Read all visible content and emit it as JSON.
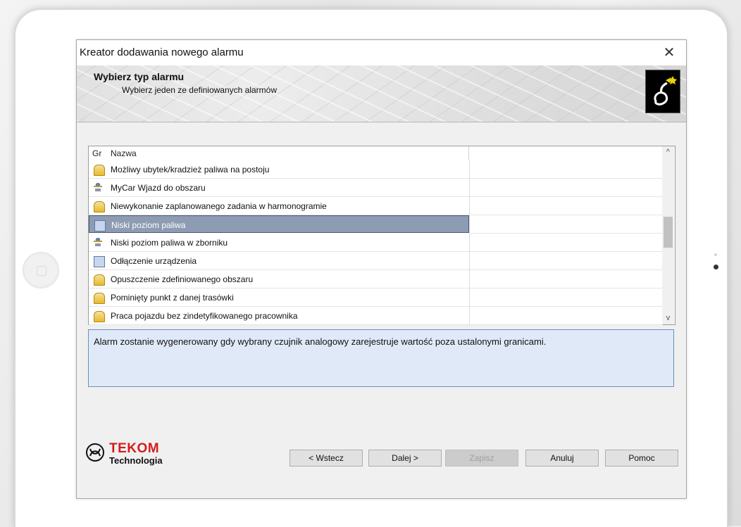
{
  "dialog": {
    "title": "Kreator dodawania nowego alarmu",
    "close_glyph": "✕"
  },
  "banner": {
    "title": "Wybierz typ alarmu",
    "subtitle": "Wybierz jeden ze definiowanych alarmów",
    "icon": "wizard-icon"
  },
  "list": {
    "columns": [
      "Gr",
      "Nazwa"
    ],
    "rows": [
      {
        "icon": "bell-icon",
        "label": "Możliwy ubytek/kradzież paliwa na postoju",
        "selected": false
      },
      {
        "icon": "people-icon",
        "label": "MyCar Wjazd do obszaru",
        "selected": false
      },
      {
        "icon": "bell-icon",
        "label": "Niewykonanie zaplanowanego zadania w harmonogramie",
        "selected": false
      },
      {
        "icon": "device-icon",
        "label": "Niski poziom paliwa",
        "selected": true
      },
      {
        "icon": "people-icon",
        "label": "Niski poziom paliwa w zborniku",
        "selected": false
      },
      {
        "icon": "device-icon",
        "label": "Odłączenie urządzenia",
        "selected": false
      },
      {
        "icon": "bell-icon",
        "label": "Opuszczenie zdefiniowanego obszaru",
        "selected": false
      },
      {
        "icon": "bell-icon",
        "label": "Pominięty punkt z danej trasówki",
        "selected": false
      },
      {
        "icon": "bell-icon",
        "label": "Praca pojazdu bez zindetyfikowanego pracownika",
        "selected": false
      }
    ],
    "scroll_up_glyph": "^",
    "scroll_down_glyph": "v"
  },
  "description": "Alarm zostanie wygenerowany gdy wybrany czujnik analogowy zarejestruje wartość poza ustalonymi granicami.",
  "logo": {
    "brand": "TEKOM",
    "tagline": "Technologia"
  },
  "buttons": {
    "back": "< Wstecz",
    "next": "Dalej >",
    "save": "Zapisz",
    "cancel": "Anuluj",
    "help": "Pomoc"
  },
  "colors": {
    "selection": "#8d9bb3",
    "description_bg": "#dfe9f8",
    "brand_red": "#d21d1d"
  }
}
